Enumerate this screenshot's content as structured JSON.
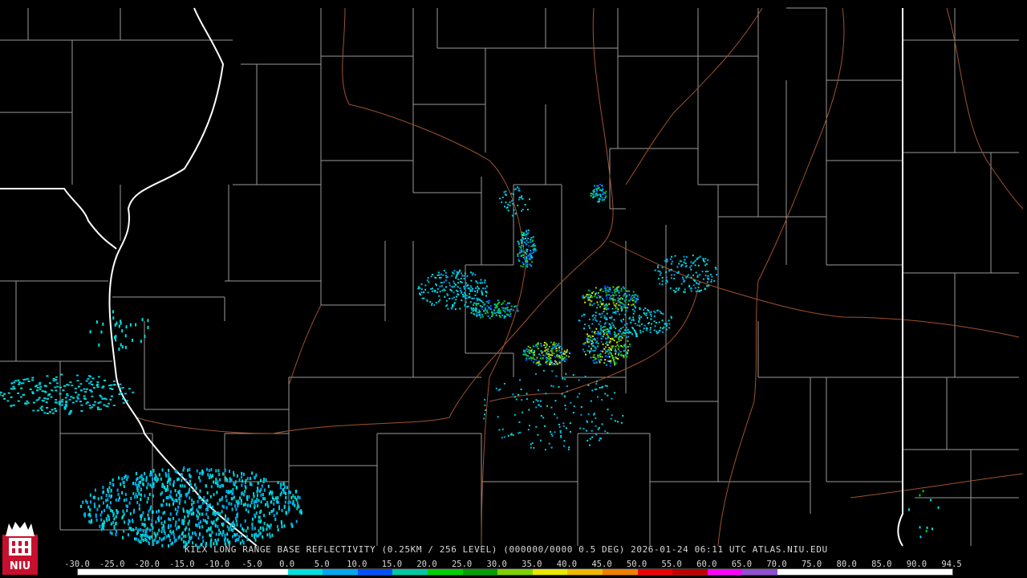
{
  "radar": {
    "station": "KILX",
    "product": "KILX LONG RANGE BASE REFLECTIVITY (0.25KM / 256 LEVEL) (000000/0000 0.5 DEG) 2026-01-24 06:11 UTC  ATLAS.NIU.EDU",
    "timestamp": "2026-01-24 06:11 UTC",
    "site": "ATLAS.NIU.EDU"
  },
  "logo": {
    "text": "NIU"
  },
  "scale": {
    "labels": [
      "-30.0",
      "-25.0",
      "-20.0",
      "-15.0",
      "-10.0",
      "-5.0",
      "0.0",
      "5.0",
      "10.0",
      "15.0",
      "20.0",
      "25.0",
      "30.0",
      "35.0",
      "40.0",
      "45.0",
      "50.0",
      "55.0",
      "60.0",
      "65.0",
      "70.0",
      "75.0",
      "80.0",
      "85.0",
      "90.0",
      "94.5"
    ],
    "colors": [
      "#ffffff",
      "#ffffff",
      "#ffffff",
      "#ffffff",
      "#ffffff",
      "#ffffff",
      "#00e0e0",
      "#00a8f0",
      "#0050ff",
      "#00c8a0",
      "#00d000",
      "#00a000",
      "#80d000",
      "#e8e800",
      "#f0b800",
      "#f08000",
      "#f00000",
      "#c00000",
      "#ff00ff",
      "#9050d0",
      "#ffffff",
      "#ffffff",
      "#ffffff",
      "#ffffff",
      "#ffffff"
    ]
  },
  "map_colors": {
    "state_border": "#ffffff",
    "county_border": "#9a9a9a",
    "highway": "#a0522d"
  }
}
